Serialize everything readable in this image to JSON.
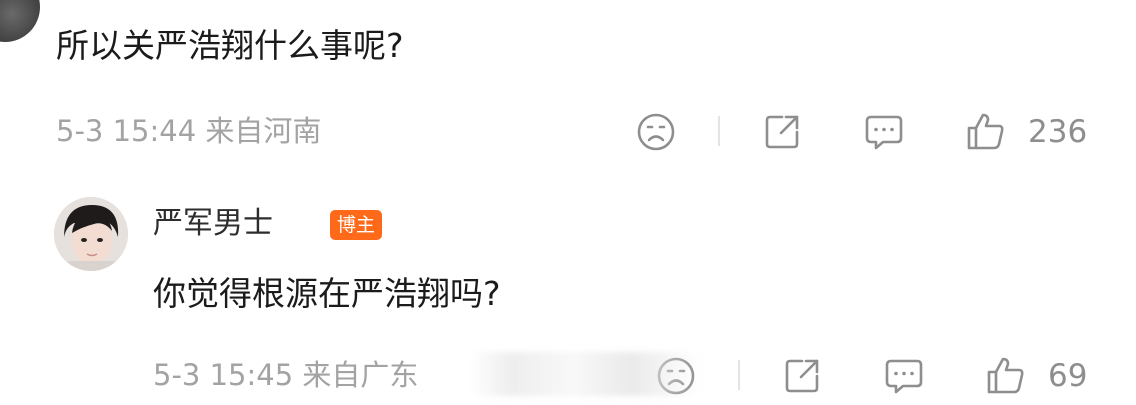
{
  "comments": [
    {
      "text": "所以关严浩翔什么事呢?",
      "meta": "5-3 15:44 来自河南",
      "like_count": "236",
      "icons": [
        "sad-face-icon",
        "share-icon",
        "comment-icon",
        "thumbs-up-icon"
      ]
    },
    {
      "username": "严军男士",
      "badge": "博主",
      "text": "你觉得根源在严浩翔吗?",
      "meta": "5-3 15:45 来自广东",
      "like_count": "69",
      "icons": [
        "sad-face-icon",
        "share-icon",
        "comment-icon",
        "thumbs-up-icon"
      ]
    }
  ],
  "colors": {
    "text": "#1b1b1b",
    "meta": "#a3a3a3",
    "icon": "#8e8e8e",
    "badge": "#ff6a1a"
  }
}
